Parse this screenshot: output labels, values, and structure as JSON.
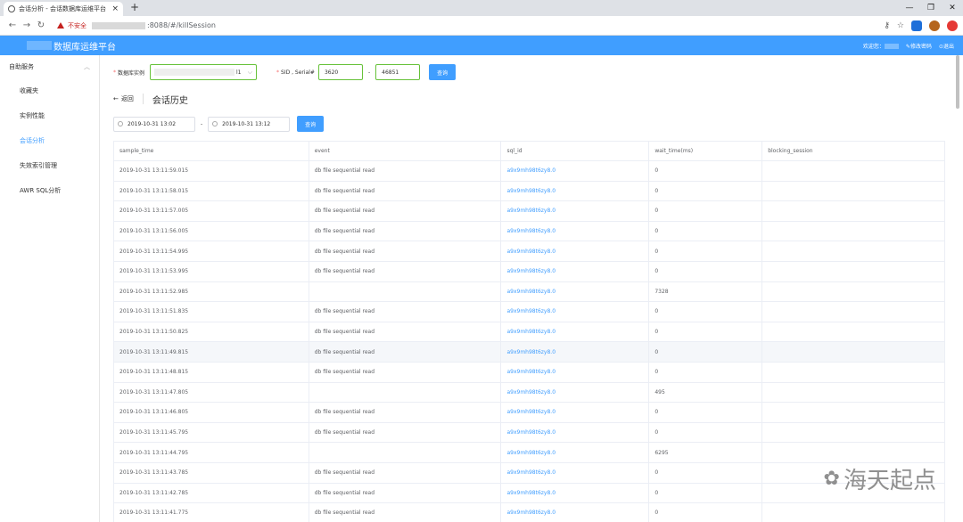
{
  "browser": {
    "tab_title": "会话分析 - 会话数据库运维平台",
    "tab_close": "×",
    "newtab": "+",
    "security": "不安全",
    "url": ":8088/#/killSession"
  },
  "app": {
    "title": "数据库运维平台",
    "welcome": "欢迎您：",
    "change_password": "修改密码",
    "logout": "退出"
  },
  "sidebar": {
    "group": "自助服务",
    "items": [
      {
        "label": "收藏夹"
      },
      {
        "label": "实例性能"
      },
      {
        "label": "会话分析"
      },
      {
        "label": "失效索引管理"
      },
      {
        "label": "AWR SQL分析"
      }
    ]
  },
  "filters": {
    "instance_label": "数据库实例",
    "instance_suffix": "l1",
    "sid_label": "SID , Serial#",
    "sid": "3620",
    "serial": "46851",
    "query": "查询"
  },
  "page": {
    "back": "返回",
    "title": "会话历史",
    "date_from": "2019-10-31 13:02",
    "date_to": "2019-10-31 13:12",
    "date_sep": "-",
    "query": "查询"
  },
  "table": {
    "headers": [
      "sample_time",
      "event",
      "sql_id",
      "wait_time(ms)",
      "blocking_session"
    ],
    "rows": [
      [
        "2019-10-31 13:11:59.015",
        "db file sequential read",
        "a9x9mh98t6zy8.0",
        "0",
        ""
      ],
      [
        "2019-10-31 13:11:58.015",
        "db file sequential read",
        "a9x9mh98t6zy8.0",
        "0",
        ""
      ],
      [
        "2019-10-31 13:11:57.005",
        "db file sequential read",
        "a9x9mh98t6zy8.0",
        "0",
        ""
      ],
      [
        "2019-10-31 13:11:56.005",
        "db file sequential read",
        "a9x9mh98t6zy8.0",
        "0",
        ""
      ],
      [
        "2019-10-31 13:11:54.995",
        "db file sequential read",
        "a9x9mh98t6zy8.0",
        "0",
        ""
      ],
      [
        "2019-10-31 13:11:53.995",
        "db file sequential read",
        "a9x9mh98t6zy8.0",
        "0",
        ""
      ],
      [
        "2019-10-31 13:11:52.985",
        "",
        "a9x9mh98t6zy8.0",
        "7328",
        ""
      ],
      [
        "2019-10-31 13:11:51.835",
        "db file sequential read",
        "a9x9mh98t6zy8.0",
        "0",
        ""
      ],
      [
        "2019-10-31 13:11:50.825",
        "db file sequential read",
        "a9x9mh98t6zy8.0",
        "0",
        ""
      ],
      [
        "2019-10-31 13:11:49.815",
        "db file sequential read",
        "a9x9mh98t6zy8.0",
        "0",
        ""
      ],
      [
        "2019-10-31 13:11:48.815",
        "db file sequential read",
        "a9x9mh98t6zy8.0",
        "0",
        ""
      ],
      [
        "2019-10-31 13:11:47.805",
        "",
        "a9x9mh98t6zy8.0",
        "495",
        ""
      ],
      [
        "2019-10-31 13:11:46.805",
        "db file sequential read",
        "a9x9mh98t6zy8.0",
        "0",
        ""
      ],
      [
        "2019-10-31 13:11:45.795",
        "db file sequential read",
        "a9x9mh98t6zy8.0",
        "0",
        ""
      ],
      [
        "2019-10-31 13:11:44.795",
        "",
        "a9x9mh98t6zy8.0",
        "6295",
        ""
      ],
      [
        "2019-10-31 13:11:43.785",
        "db file sequential read",
        "a9x9mh98t6zy8.0",
        "0",
        ""
      ],
      [
        "2019-10-31 13:11:42.785",
        "db file sequential read",
        "a9x9mh98t6zy8.0",
        "0",
        ""
      ],
      [
        "2019-10-31 13:11:41.775",
        "db file sequential read",
        "a9x9mh98t6zy8.0",
        "0",
        ""
      ]
    ]
  },
  "watermark": "海天起点",
  "colors": {
    "accent": "#409eff",
    "header": "#409eff",
    "active": "#409eff"
  }
}
